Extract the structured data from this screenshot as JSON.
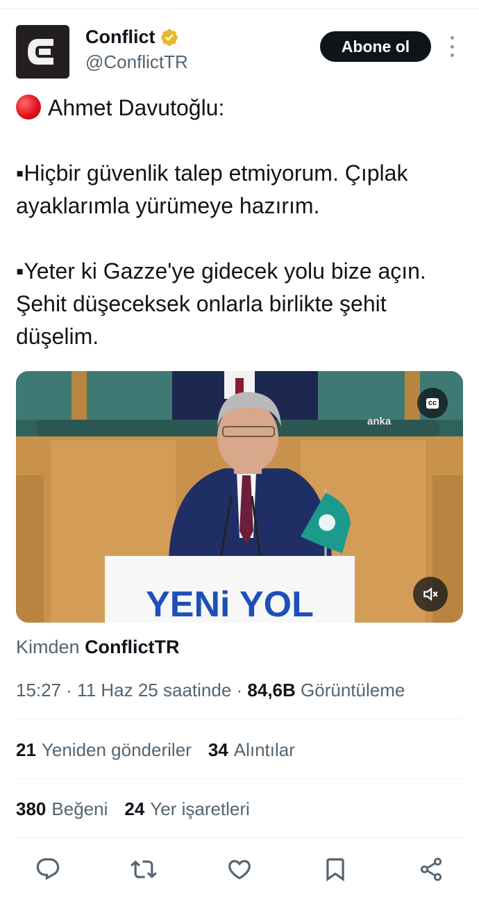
{
  "author": {
    "display_name": "Conflict",
    "handle": "@ConflictTR",
    "avatar_icon": "conflict-c-logo",
    "verified": true,
    "verified_color": "#e8b829"
  },
  "header": {
    "subscribe_label": "Abone ol",
    "more_icon": "more-vertical-icon"
  },
  "tweet": {
    "line_1": "Ahmet Davutoğlu:",
    "line_2": "▪Hiçbir güvenlik talep etmiyorum. Çıplak ayaklarımla yürümeye hazırım.",
    "line_3": "▪Yeter ki Gazze'ye gidecek yolu bize açın. Şehit düşeceksek onlarla birlikte şehit düşelim."
  },
  "video": {
    "podium_text": "YENi YOL",
    "watermark": "anka",
    "cc_label": "cc",
    "mute_icon": "volume-muted-icon"
  },
  "source": {
    "prefix": "Kimden",
    "name": "ConflictTR"
  },
  "meta": {
    "time_date": "15:27 · 11 Haz 25 saatinde · ",
    "views_count": "84,6B",
    "views_label": "Görüntüleme"
  },
  "stats": {
    "reposts_count": "21",
    "reposts_label": "Yeniden gönderiler",
    "quotes_count": "34",
    "quotes_label": "Alıntılar",
    "likes_count": "380",
    "likes_label": "Beğeni",
    "bookmarks_count": "24",
    "bookmarks_label": "Yer işaretleri"
  },
  "actions": [
    "reply-icon",
    "repost-icon",
    "like-icon",
    "bookmark-icon",
    "share-icon"
  ],
  "colors": {
    "text": "#0f1419",
    "secondary": "#536471",
    "divider": "#eff3f4",
    "podium_blue": "#1d4fb8"
  }
}
